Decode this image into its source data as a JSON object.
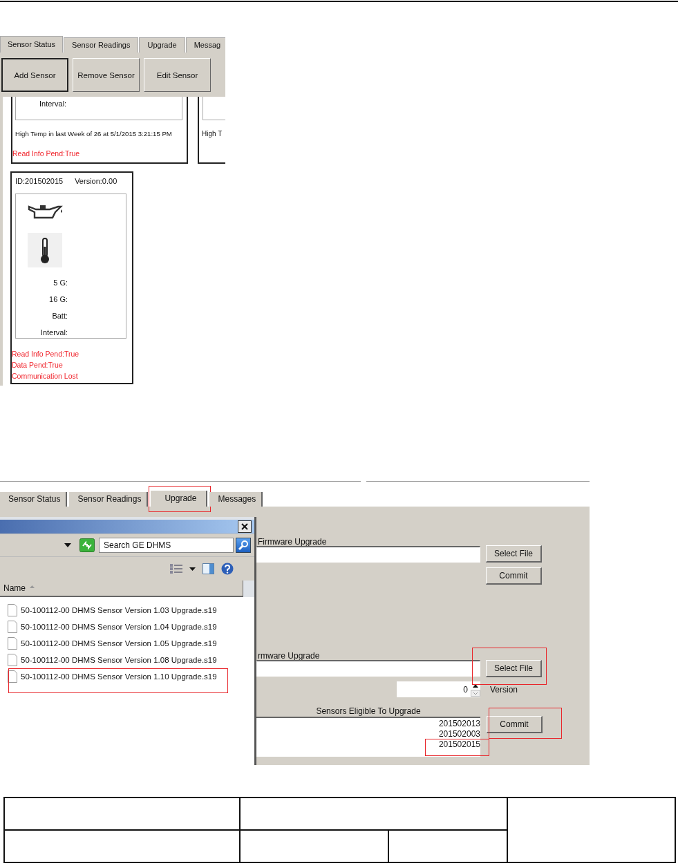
{
  "sensor_status_screenshot": {
    "tabs": [
      {
        "label": "Sensor Status",
        "selected": true
      },
      {
        "label": "Sensor Readings",
        "selected": false
      },
      {
        "label": "Upgrade",
        "selected": false
      },
      {
        "label": "Messag",
        "selected": false
      }
    ],
    "buttons": [
      {
        "label": "Add Sensor",
        "default": true
      },
      {
        "label": "Remove Sensor",
        "default": false
      },
      {
        "label": "Edit Sensor",
        "default": false
      }
    ],
    "sensor_cards": [
      {
        "kind": "partial",
        "fields": [
          "Interval:"
        ],
        "alert": "High Temp in last Week of 26 at 5/1/2015 3:21:15 PM",
        "status_lines": [
          "Read Info Pend:True"
        ]
      },
      {
        "kind": "edge",
        "alert": "High T"
      },
      {
        "kind": "full",
        "id": "ID:201502015",
        "version": "Version:0.00",
        "fields": [
          "5 G:",
          "16 G:",
          "Batt:",
          "Interval:"
        ],
        "status_lines": [
          "Read Info Pend:True",
          "Data Pend:True",
          "Communication Lost"
        ]
      }
    ]
  },
  "upgrade_screenshot": {
    "tabs": [
      {
        "label": "Sensor Status",
        "selected": false,
        "highlighted": false
      },
      {
        "label": "Sensor Readings",
        "selected": false,
        "highlighted": false
      },
      {
        "label": "Upgrade",
        "selected": true,
        "highlighted": true
      },
      {
        "label": "Messages",
        "selected": false,
        "highlighted": false
      }
    ],
    "file_dialog": {
      "search": {
        "placeholder": "Search GE DHMS"
      },
      "column": "Name",
      "files": [
        {
          "name": "50-100112-00 DHMS Sensor Version 1.03 Upgrade.s19",
          "highlighted": false
        },
        {
          "name": "50-100112-00 DHMS Sensor Version 1.04 Upgrade.s19",
          "highlighted": false
        },
        {
          "name": "50-100112-00 DHMS Sensor Version 1.05 Upgrade.s19",
          "highlighted": false
        },
        {
          "name": "50-100112-00 DHMS Sensor Version 1.08 Upgrade.s19",
          "highlighted": false
        },
        {
          "name": "50-100112-00 DHMS Sensor Version 1.10 Upgrade.s19",
          "highlighted": true
        }
      ]
    },
    "upper_section": {
      "title": "Firmware Upgrade",
      "select_button": {
        "label": "Select File",
        "highlighted": false
      },
      "commit_button": {
        "label": "Commit",
        "highlighted": false
      }
    },
    "lower_section": {
      "title": "rmware Upgrade",
      "select_button": {
        "label": "Select File",
        "highlighted": true
      },
      "version": {
        "value": "0",
        "label": "Version"
      },
      "eligible": {
        "title": "Sensors Eligible To Upgrade",
        "sensors": [
          {
            "id": "201502013",
            "highlighted": false
          },
          {
            "id": "201502003",
            "highlighted": false
          },
          {
            "id": "201502015",
            "highlighted": true
          }
        ]
      },
      "commit_button": {
        "label": "Commit",
        "highlighted": true
      }
    }
  }
}
